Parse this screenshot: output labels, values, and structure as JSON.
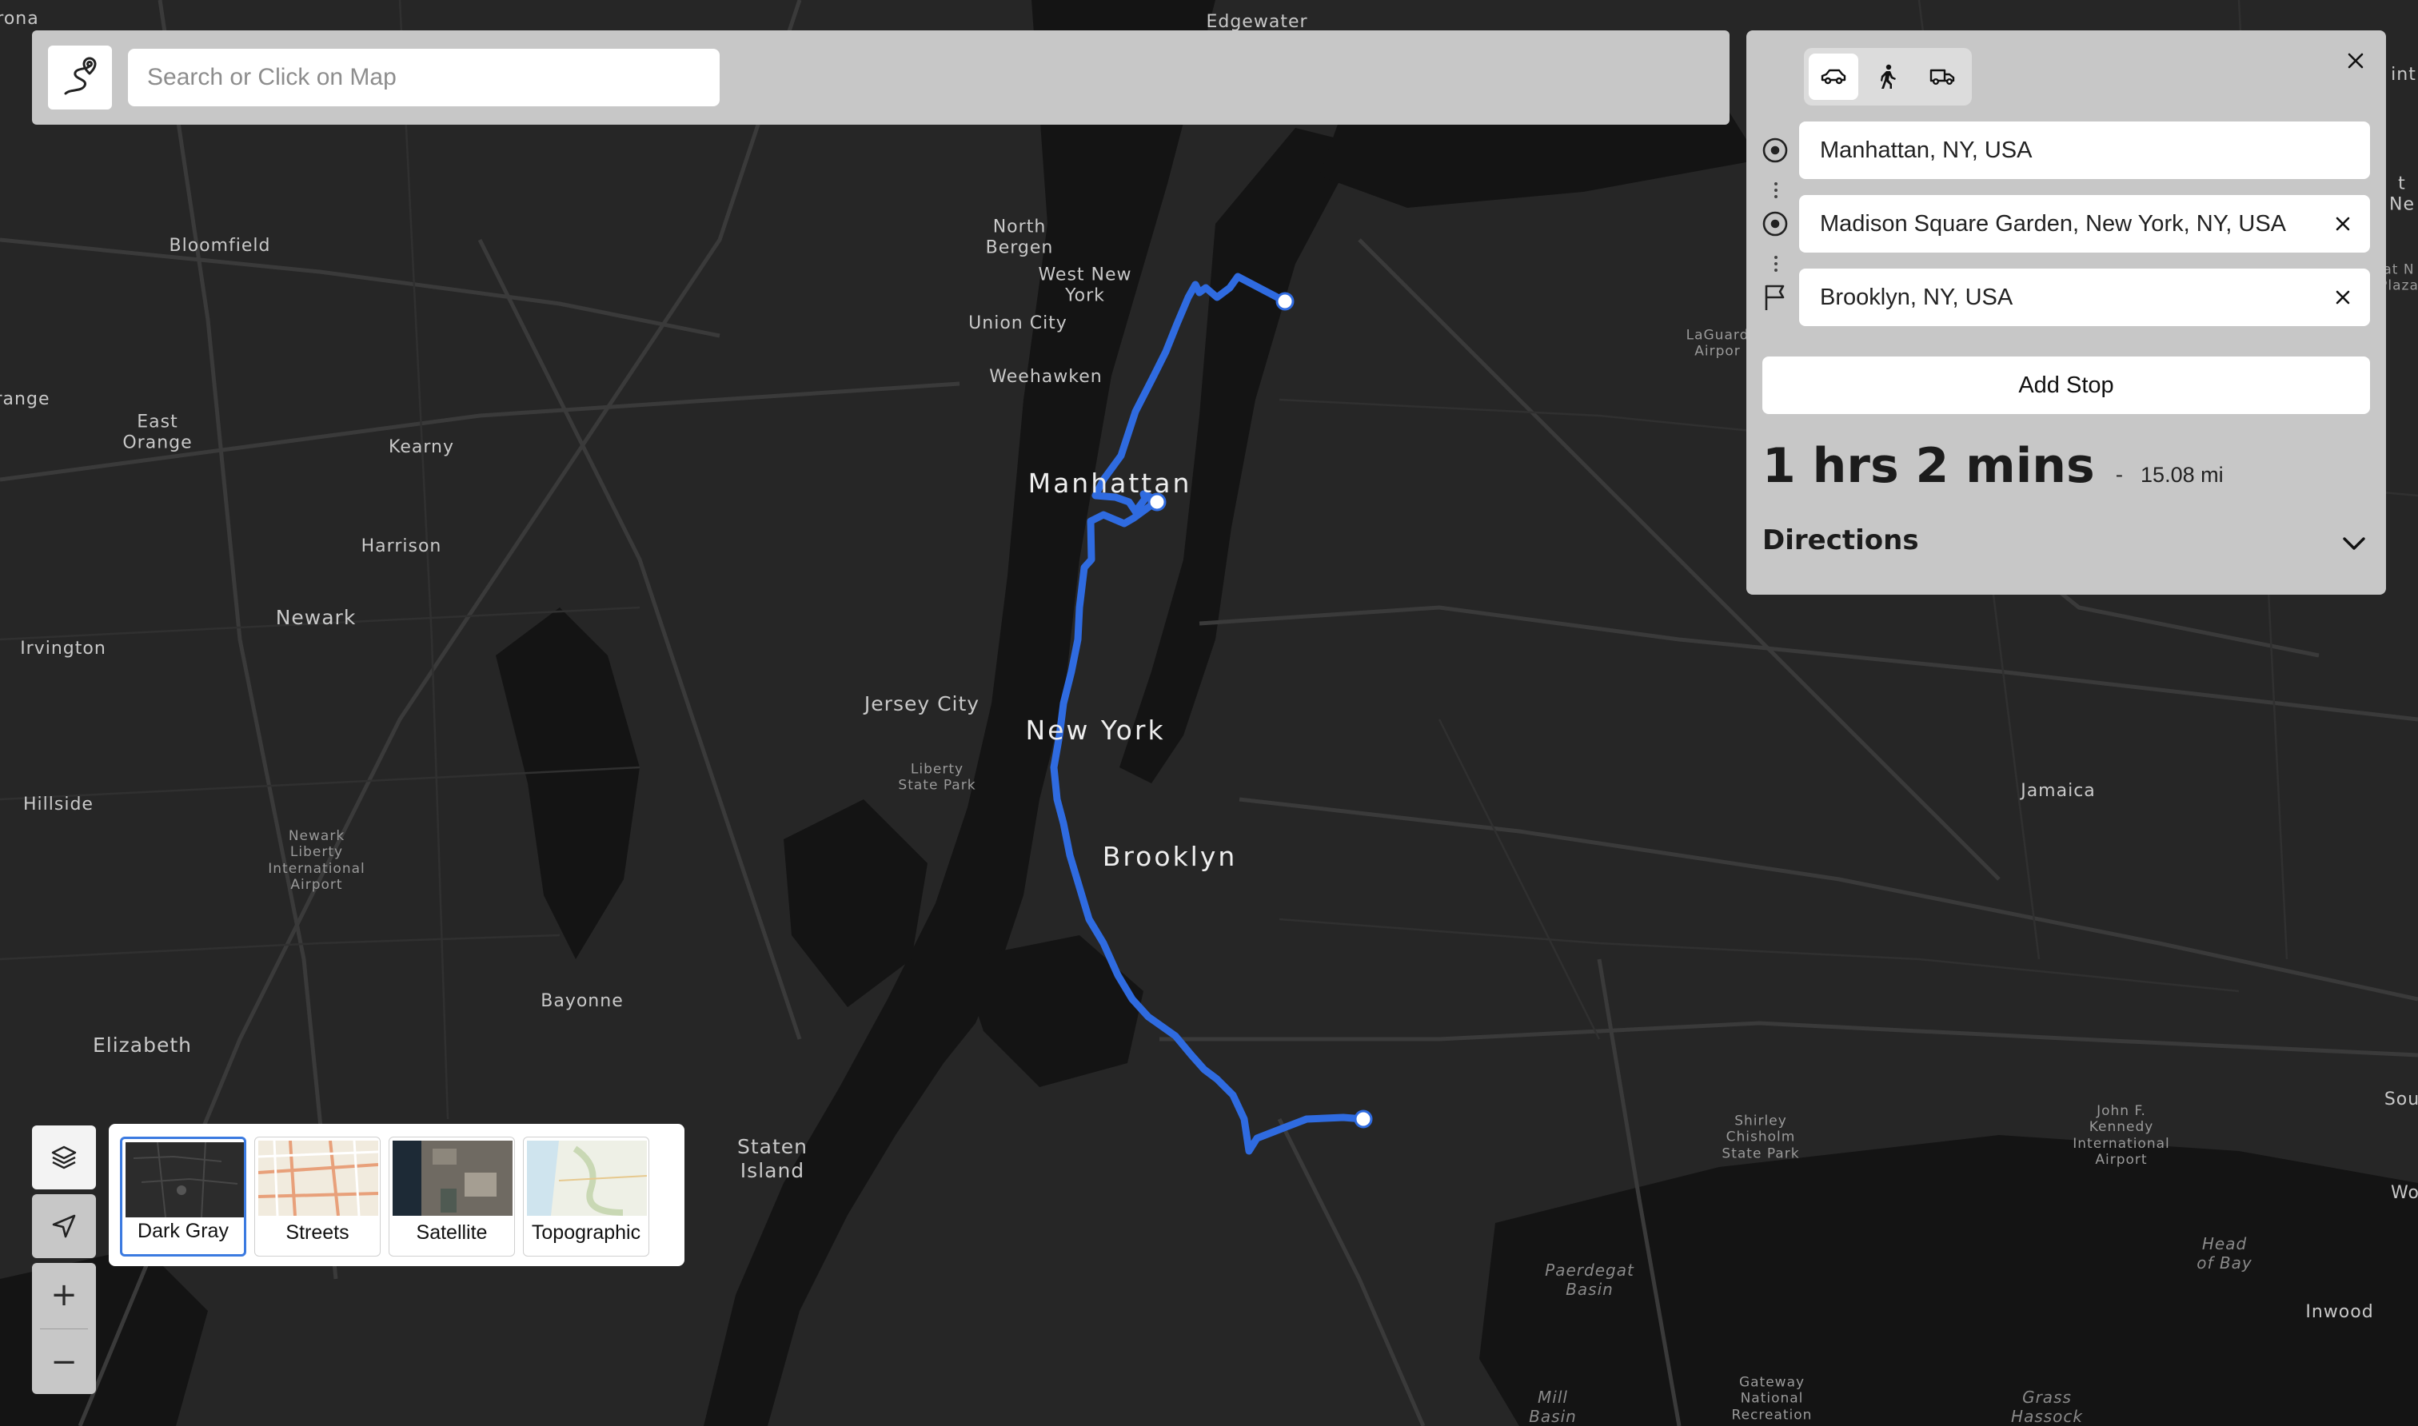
{
  "search": {
    "placeholder": "Search or Click on Map"
  },
  "icons": {
    "logo": "route-logo-icon",
    "car": "car-icon",
    "walk": "walk-icon",
    "truck": "truck-icon",
    "close": "close-icon",
    "origin": "circle-target-icon",
    "destination": "flag-icon",
    "clear": "clear-x-icon",
    "chevron": "chevron-down-icon",
    "layers": "layers-icon",
    "locate": "navigation-arrow-icon"
  },
  "route_panel": {
    "travel_modes": [
      "car",
      "walk",
      "truck"
    ],
    "active_mode": "car",
    "stops": [
      {
        "value": "Manhattan, NY, USA",
        "clearable": false
      },
      {
        "value": "Madison Square Garden, New York, NY, USA",
        "clearable": true
      },
      {
        "value": "Brooklyn, NY, USA",
        "clearable": true
      }
    ],
    "add_stop_label": "Add Stop",
    "duration": "1 hrs 2 mins",
    "separator": "-",
    "distance": "15.08 mi",
    "directions_label": "Directions"
  },
  "zoom": {
    "in_label": "+",
    "out_label": "−"
  },
  "basemaps": [
    {
      "label": "Dark Gray",
      "selected": true
    },
    {
      "label": "Streets",
      "selected": false
    },
    {
      "label": "Satellite",
      "selected": false
    },
    {
      "label": "Topographic",
      "selected": false
    }
  ],
  "map": {
    "route_color": "#2f6be0",
    "labels": {
      "edgewater": "Edgewater",
      "rona": "rona",
      "bloomfield": "Bloomfield",
      "north_bergen": "North\nBergen",
      "west_new_york": "West New\nYork",
      "union_city": "Union City",
      "weehawken": "Weehawken",
      "range": "range",
      "east_orange": "East\nOrange",
      "kearny": "Kearny",
      "harrison": "Harrison",
      "newark": "Newark",
      "irvington": "Irvington",
      "manhattan": "Manhattan",
      "jersey_city": "Jersey City",
      "liberty_state_park": "Liberty\nState Park",
      "new_york": "New York",
      "hillside": "Hillside",
      "newark_airport": "Newark\nLiberty\nInternational\nAirport",
      "brooklyn": "Brooklyn",
      "jamaica": "Jamaica",
      "laguardia": "LaGuard\nAirpor",
      "bayonne": "Bayonne",
      "elizabeth": "Elizabeth",
      "staten_island": "Staten\nIsland",
      "shirley_chisholm": "Shirley\nChisholm\nState Park",
      "jfk": "John F.\nKennedy\nInternational\nAirport",
      "head_of_bay": "Head\nof Bay",
      "paerdegat_basin": "Paerdegat\nBasin",
      "inwood": "Inwood",
      "gateway": "Gateway\nNational\nRecreation",
      "mill_basin": "Mill\nBasin",
      "grass_hassock": "Grass\nHassock",
      "sou": "Sou",
      "wo": "Wo",
      "ne": "t Ne",
      "int": "int",
      "plaza": "at N\nPlaza"
    }
  }
}
